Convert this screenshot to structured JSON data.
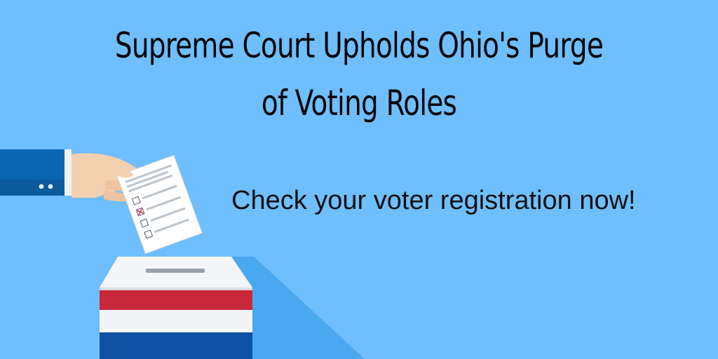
{
  "headline": "Supreme Court Upholds Ohio's Purge of Voting Roles",
  "tagline": "Check your voter registration now!",
  "colors": {
    "background": "#6fbefd",
    "box_shadow": "#4aa8f1",
    "stripe_red": "#c8283a",
    "stripe_white": "#f3f4f6",
    "stripe_blue": "#0f52a5",
    "sleeve": "#0b66b0",
    "skin": "#f2d0b0",
    "ballot_check": "#d8354a"
  },
  "icons": {
    "illustration": "ballot-box-with-hand-illustration"
  }
}
